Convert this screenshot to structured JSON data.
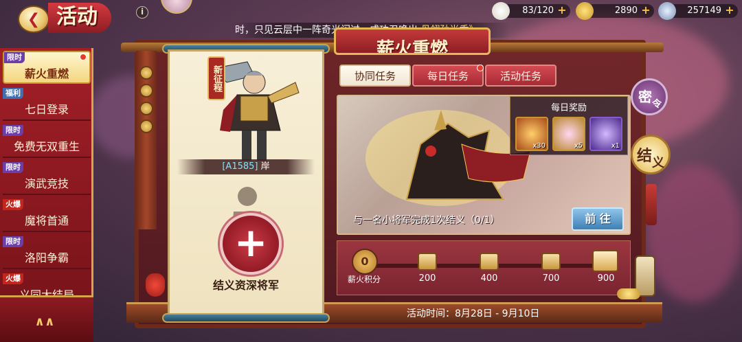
{
  "header": {
    "title": "活动",
    "back_icon": "back-arrow-icon",
    "info_icon": "info-icon"
  },
  "resources": [
    {
      "name": "stamina",
      "value": "83/120",
      "icon": "bun-icon"
    },
    {
      "name": "gold",
      "value": "2890",
      "icon": "gold-ingot-icon"
    },
    {
      "name": "coin",
      "value": "257149",
      "icon": "silver-coin-icon"
    }
  ],
  "marquee": {
    "text": "时，只见云层中一阵奇光闪过，成功召唤出",
    "highlight": "丹翎孙尚香》"
  },
  "sidebar": {
    "items": [
      {
        "tag": "限时",
        "tag_type": "limited",
        "label": "薪火重燃",
        "active": true,
        "dot": true
      },
      {
        "tag": "福利",
        "tag_type": "fuli",
        "label": "七日登录",
        "active": false,
        "dot": false
      },
      {
        "tag": "限时",
        "tag_type": "limited",
        "label": "免费无双重生",
        "active": false,
        "dot": false
      },
      {
        "tag": "限时",
        "tag_type": "limited",
        "label": "演武竞技",
        "active": false,
        "dot": false
      },
      {
        "tag": "火爆",
        "tag_type": "hot",
        "label": "魔将首通",
        "active": false,
        "dot": false
      },
      {
        "tag": "限时",
        "tag_type": "limited",
        "label": "洛阳争霸",
        "active": false,
        "dot": false
      },
      {
        "tag": "火爆",
        "tag_type": "hot",
        "label": "义同大结局",
        "active": false,
        "dot": false
      }
    ],
    "collapse_icon": "double-chevron-up-icon"
  },
  "panel": {
    "banner": "薪火重燃",
    "badge": "新征程",
    "hero_code": "[A1585]",
    "hero_name": "岸",
    "add_symbol": "+",
    "add_label": "结义资深将军"
  },
  "tabs": [
    {
      "label": "协同任务",
      "active": true,
      "dot": false
    },
    {
      "label": "每日任务",
      "active": false,
      "dot": true
    },
    {
      "label": "活动任务",
      "active": false,
      "dot": false
    }
  ],
  "task": {
    "description": "与一名小将军完成1次结义（0/1）",
    "go_label": "前 往",
    "daily_reward_title": "每日奖励",
    "rewards": [
      {
        "name": "fire-brazier",
        "count": "x30",
        "color": "#f0a23a"
      },
      {
        "name": "treasure-chest",
        "count": "x5",
        "color": "#e8b64a"
      },
      {
        "name": "purple-crystal",
        "count": "x1",
        "color": "#7a4cc8"
      }
    ]
  },
  "progress": {
    "score": "0",
    "score_label": "薪火积分",
    "fraction": 0,
    "milestones": [
      "200",
      "400",
      "700",
      "900"
    ]
  },
  "activity_time": "活动时间：8月28日 - 9月10日",
  "right_buttons": {
    "mi": [
      "密",
      "令"
    ],
    "jie": [
      "结",
      "义"
    ]
  },
  "colors": {
    "accent_red": "#a31f27",
    "gold": "#d7a54a",
    "tab_active": "#fffaf0",
    "go_button": "#3f7fb3"
  }
}
